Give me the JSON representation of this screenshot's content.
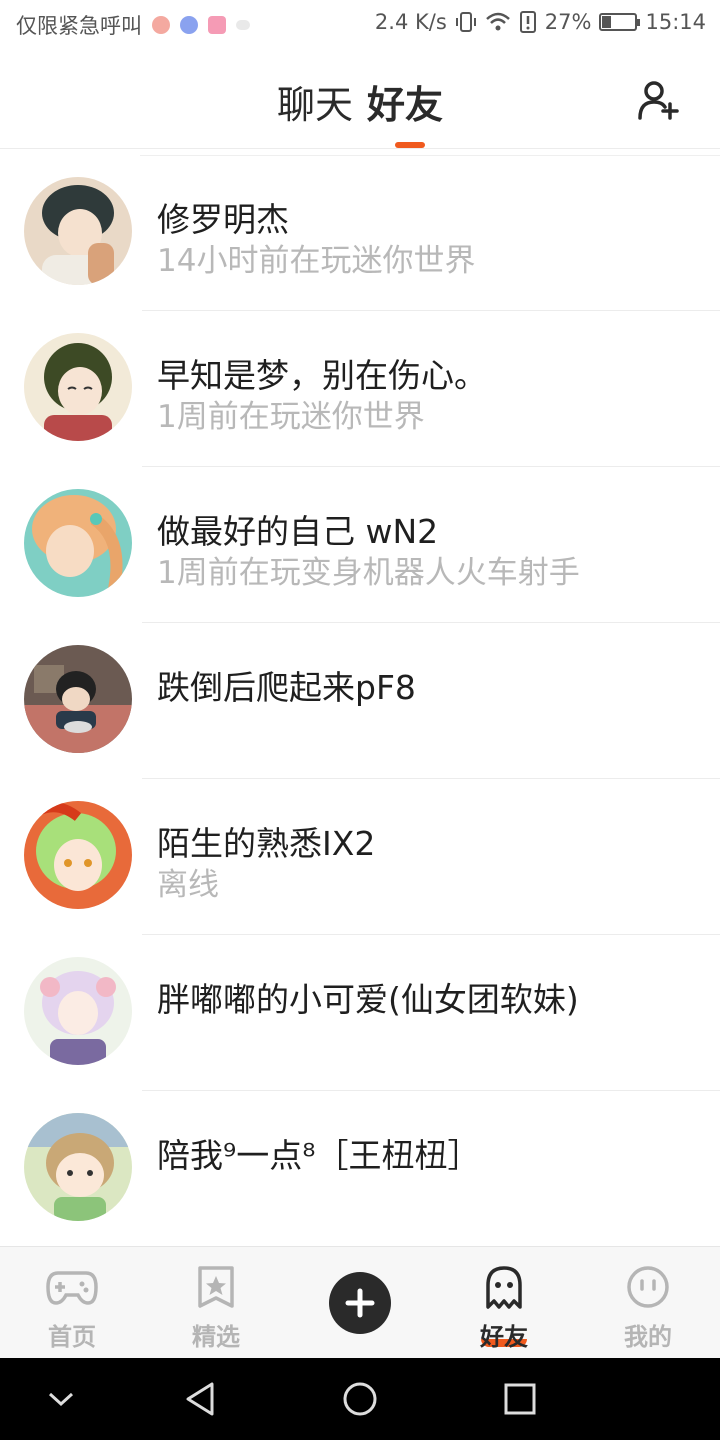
{
  "status_bar": {
    "carrier_text": "仅限紧急呼叫",
    "network_speed": "2.4 K/s",
    "battery_percent": "27%",
    "battery_level": 0.27,
    "time": "15:14",
    "icons": [
      "weibo-icon",
      "music-icon",
      "app-store-icon",
      "vibrate-icon",
      "wifi-icon",
      "signal-alert-icon",
      "battery-charging-icon"
    ]
  },
  "header": {
    "tabs": [
      {
        "label": "聊天",
        "active": false
      },
      {
        "label": "好友",
        "active": true
      }
    ],
    "add_friend_icon": "add-user-icon",
    "accent": "#f05a1e"
  },
  "friends": [
    {
      "name": "修罗明杰",
      "status": "14小时前在玩迷你世界"
    },
    {
      "name": "早知是梦，别在伤心。",
      "status": "1周前在玩迷你世界"
    },
    {
      "name": "做最好的自己 wN2",
      "status": "1周前在玩变身机器人火车射手"
    },
    {
      "name": "跌倒后爬起来pF8",
      "status": ""
    },
    {
      "name": "陌生的熟悉IX2",
      "status": "离线"
    },
    {
      "name": "胖嘟嘟的小可爱(仙女团软妹)",
      "status": ""
    },
    {
      "name": "陪我⁹一点⁸［王杻杻］",
      "status": ""
    }
  ],
  "bottom_nav": {
    "items": [
      {
        "label": "首页",
        "icon": "gamepad-icon",
        "active": false
      },
      {
        "label": "精选",
        "icon": "star-bookmark-icon",
        "active": false
      },
      {
        "label": "好友",
        "icon": "ghost-icon",
        "active": true
      },
      {
        "label": "我的",
        "icon": "smiley-icon",
        "active": false
      }
    ],
    "center_button_icon": "plus-icon"
  },
  "system_nav": {
    "icons": [
      "chevron-down-icon",
      "back-triangle-icon",
      "home-circle-icon",
      "recents-square-icon"
    ]
  }
}
